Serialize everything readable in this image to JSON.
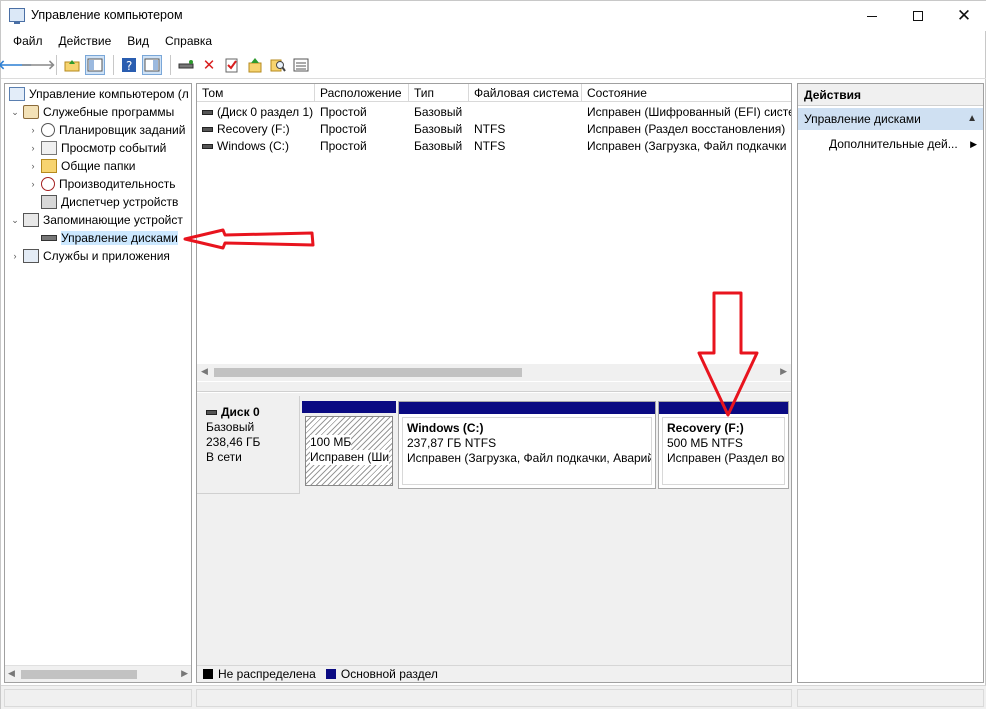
{
  "window": {
    "title": "Управление компьютером",
    "min_label": "—",
    "max_label": "☐",
    "close_label": "✕"
  },
  "menu": [
    "Файл",
    "Действие",
    "Вид",
    "Справка"
  ],
  "toolbar": {
    "icons": [
      "back-arrow",
      "forward-arrow",
      "up-folder",
      "show-hide-tree",
      "help",
      "show-hide-action-pane",
      "connect-disk",
      "delete",
      "properties",
      "export",
      "find",
      "list-view"
    ]
  },
  "tree": {
    "root": "Управление компьютером (л",
    "utilities": "Служебные программы",
    "task_scheduler": "Планировщик заданий",
    "event_viewer": "Просмотр событий",
    "shared_folders": "Общие папки",
    "performance": "Производительность",
    "device_manager": "Диспетчер устройств",
    "storage": "Запоминающие устройст",
    "disk_management": "Управление дисками",
    "services": "Службы и приложения"
  },
  "volumes": {
    "headers": [
      "Том",
      "Расположение",
      "Тип",
      "Файловая система",
      "Состояние"
    ],
    "rows": [
      [
        "(Диск 0 раздел 1)",
        "Простой",
        "Базовый",
        "",
        "Исправен (Шифрованный (EFI) систе"
      ],
      [
        "Recovery (F:)",
        "Простой",
        "Базовый",
        "NTFS",
        "Исправен (Раздел восстановления)"
      ],
      [
        "Windows (C:)",
        "Простой",
        "Базовый",
        "NTFS",
        "Исправен (Загрузка, Файл подкачки"
      ]
    ]
  },
  "disk0": {
    "name": "Диск 0",
    "type": "Базовый",
    "size": "238,46 ГБ",
    "status": "В сети"
  },
  "partitions": {
    "efi": {
      "size": "100 МБ",
      "status": "Исправен (Ши"
    },
    "windows": {
      "name": "Windows  (C:)",
      "size": "237,87 ГБ NTFS",
      "status": "Исправен (Загрузка, Файл подкачки, Аварий"
    },
    "recovery": {
      "name": "Recovery  (F:)",
      "size": "500 МБ NTFS",
      "status": "Исправен (Раздел во"
    }
  },
  "legend": {
    "unallocated": "Не распределена",
    "primary": "Основной раздел",
    "unallocated_color": "#000000",
    "primary_color": "#0a0a82"
  },
  "actions": {
    "title": "Действия",
    "section": "Управление дисками",
    "more": "Дополнительные дей..."
  },
  "colors": {
    "partition_bar": "#0a0a82",
    "selection": "#cce8ff",
    "annotation": "#e8141e"
  }
}
